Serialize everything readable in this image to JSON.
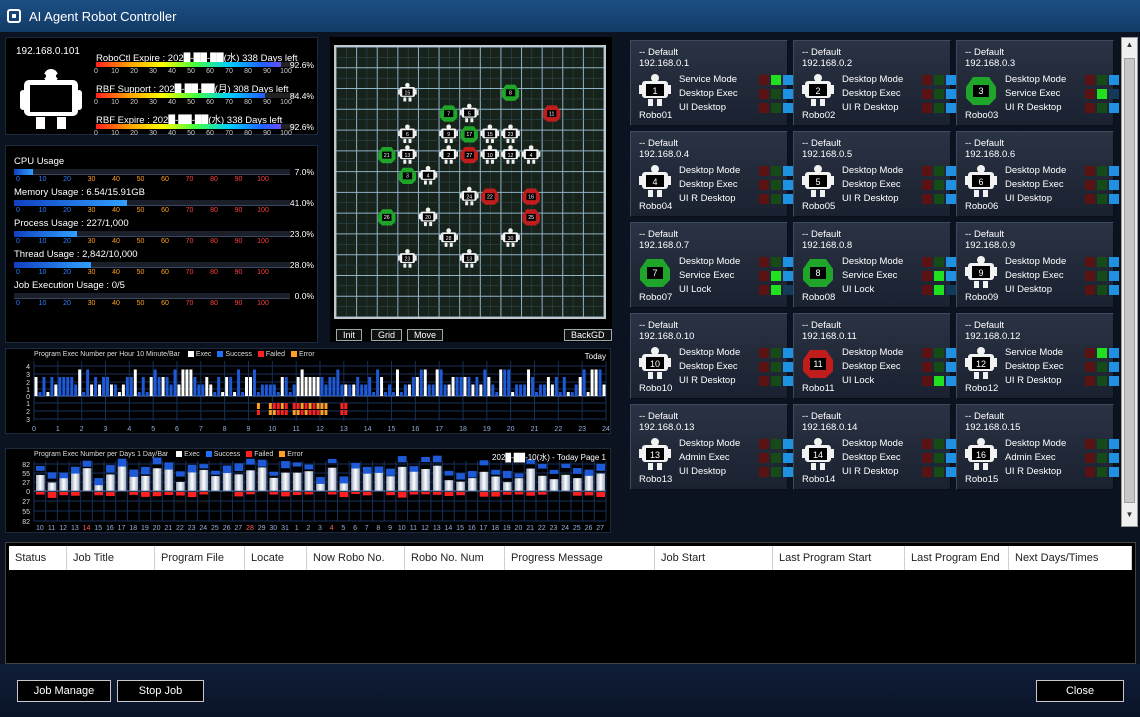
{
  "window": {
    "title": "AI Agent Robot Controller"
  },
  "info": {
    "ip": "192.168.0.101",
    "licenses": [
      {
        "text": "RoboCtl Expire : 202█-██-██(水) 338 Days left",
        "percent": "92.6%",
        "fill": 0.926
      },
      {
        "text": "RBF Support   : 202█-██-██(月) 308 Days left",
        "percent": "84.4%",
        "fill": 0.844
      },
      {
        "text": "RBF Expire    : 202█-██-██(水) 338 Days left",
        "percent": "92.6%",
        "fill": 0.926
      }
    ],
    "ticks": [
      "0",
      "10",
      "20",
      "30",
      "40",
      "50",
      "60",
      "70",
      "80",
      "90",
      "100"
    ]
  },
  "usage": [
    {
      "label": "CPU Usage",
      "percent": "7.0%",
      "fill": 0.07
    },
    {
      "label": "Memory Usage : 6.54/15.91GB",
      "percent": "41.0%",
      "fill": 0.41
    },
    {
      "label": "Process Usage : 227/1,000",
      "percent": "23.0%",
      "fill": 0.23
    },
    {
      "label": "Thread Usage : 2,842/10,000",
      "percent": "28.0%",
      "fill": 0.28
    },
    {
      "label": "Job Execution Usage : 0/5",
      "percent": "0.0%",
      "fill": 0.0
    }
  ],
  "usage_ticks": [
    "0",
    "10",
    "20",
    "30",
    "40",
    "50",
    "60",
    "70",
    "80",
    "90",
    "100"
  ],
  "map": {
    "buttons": {
      "init": "Init",
      "grid": "Grid",
      "move": "Move",
      "backgd": "BackGD"
    },
    "grid_cols": 13,
    "grid_rows": 13,
    "robots": [
      {
        "n": "15",
        "col": 3,
        "row": 2,
        "c": "w"
      },
      {
        "n": "8",
        "col": 8,
        "row": 2,
        "c": "g"
      },
      {
        "n": "7",
        "col": 5,
        "row": 3,
        "c": "g"
      },
      {
        "n": "5",
        "col": 6,
        "row": 3,
        "c": "w"
      },
      {
        "n": "11",
        "col": 10,
        "row": 3,
        "c": "r"
      },
      {
        "n": "6",
        "col": 3,
        "row": 4,
        "c": "w"
      },
      {
        "n": "9",
        "col": 5,
        "row": 4,
        "c": "w"
      },
      {
        "n": "17",
        "col": 6,
        "row": 4,
        "c": "g"
      },
      {
        "n": "15",
        "col": 7,
        "row": 4,
        "c": "w"
      },
      {
        "n": "23",
        "col": 8,
        "row": 4,
        "c": "w"
      },
      {
        "n": "21",
        "col": 2,
        "row": 5,
        "c": "g"
      },
      {
        "n": "13",
        "col": 3,
        "row": 5,
        "c": "w"
      },
      {
        "n": "2",
        "col": 5,
        "row": 5,
        "c": "w"
      },
      {
        "n": "27",
        "col": 6,
        "row": 5,
        "c": "r"
      },
      {
        "n": "10",
        "col": 7,
        "row": 5,
        "c": "w"
      },
      {
        "n": "12",
        "col": 8,
        "row": 5,
        "c": "w"
      },
      {
        "n": "4",
        "col": 9,
        "row": 5,
        "c": "w"
      },
      {
        "n": "3",
        "col": 3,
        "row": 6,
        "c": "g"
      },
      {
        "n": "4",
        "col": 4,
        "row": 6,
        "c": "w"
      },
      {
        "n": "24",
        "col": 6,
        "row": 7,
        "c": "w"
      },
      {
        "n": "22",
        "col": 7,
        "row": 7,
        "c": "r"
      },
      {
        "n": "16",
        "col": 9,
        "row": 7,
        "c": "r"
      },
      {
        "n": "26",
        "col": 2,
        "row": 8,
        "c": "g"
      },
      {
        "n": "20",
        "col": 4,
        "row": 8,
        "c": "w"
      },
      {
        "n": "25",
        "col": 9,
        "row": 8,
        "c": "r"
      },
      {
        "n": "28",
        "col": 5,
        "row": 9,
        "c": "w"
      },
      {
        "n": "30",
        "col": 8,
        "row": 9,
        "c": "w"
      },
      {
        "n": "23",
        "col": 3,
        "row": 10,
        "c": "w"
      },
      {
        "n": "13",
        "col": 6,
        "row": 10,
        "c": "w"
      }
    ]
  },
  "hour_chart": {
    "header": "Program Exec Number per Hour  10 Minute/Bar",
    "legend": [
      "Exec",
      "Success",
      "Failed",
      "Error"
    ],
    "legend_colors": [
      "#ffffff",
      "#2070ff",
      "#ff2020",
      "#ffa020"
    ],
    "right": "Today",
    "yticks": [
      "4",
      "3",
      "2",
      "1",
      "0",
      "1",
      "2",
      "3"
    ],
    "xticks": [
      "0",
      "1",
      "2",
      "3",
      "4",
      "5",
      "6",
      "7",
      "8",
      "9",
      "10",
      "11",
      "12",
      "13",
      "14",
      "15",
      "16",
      "17",
      "18",
      "19",
      "20",
      "21",
      "22",
      "23",
      "24"
    ]
  },
  "day_chart": {
    "header": "Program Exec Number per Days  1 Day/Bar",
    "legend": [
      "Exec",
      "Success",
      "Failed",
      "Error"
    ],
    "legend_colors": [
      "#ffffff",
      "#2070ff",
      "#ff2020",
      "#ffa020"
    ],
    "right": "202█-██-10(水) - Today Page 1",
    "yticks": [
      "82",
      "55",
      "27",
      "0",
      "27",
      "55",
      "82"
    ],
    "xticks": [
      "10",
      "11",
      "12",
      "13",
      "14",
      "15",
      "16",
      "17",
      "18",
      "19",
      "20",
      "21",
      "22",
      "23",
      "24",
      "25",
      "26",
      "27",
      "28",
      "29",
      "30",
      "31",
      "1",
      "2",
      "3",
      "4",
      "5",
      "6",
      "7",
      "8",
      "9",
      "10",
      "11",
      "12",
      "13",
      "14",
      "15",
      "16",
      "17",
      "18",
      "19",
      "20",
      "21",
      "22",
      "23",
      "24",
      "25",
      "26",
      "27"
    ]
  },
  "robots": [
    {
      "group": "-- Default",
      "ip": "192.168.0.1",
      "num": "1",
      "name": "Robo01",
      "color": "w",
      "rows": [
        {
          "label": "Service Mode",
          "s": [
            "off-r",
            "on-g",
            "on-b"
          ]
        },
        {
          "label": "Desktop Exec",
          "s": [
            "off-r",
            "off-g",
            "on-b"
          ]
        },
        {
          "label": "UI Desktop",
          "s": [
            "off-r",
            "off-g",
            "on-b"
          ]
        }
      ]
    },
    {
      "group": "-- Default",
      "ip": "192.168.0.2",
      "num": "2",
      "name": "Robo02",
      "color": "w",
      "rows": [
        {
          "label": "Desktop Mode",
          "s": [
            "off-r",
            "off-g",
            "on-b"
          ]
        },
        {
          "label": "Desktop Exec",
          "s": [
            "off-r",
            "off-g",
            "on-b"
          ]
        },
        {
          "label": "UI R Desktop",
          "s": [
            "off-r",
            "off-g",
            "on-b"
          ]
        }
      ]
    },
    {
      "group": "-- Default",
      "ip": "192.168.0.3",
      "num": "3",
      "name": "Robo03",
      "color": "g",
      "rows": [
        {
          "label": "Desktop Mode",
          "s": [
            "off-r",
            "off-g",
            "on-b"
          ]
        },
        {
          "label": "Service Exec",
          "s": [
            "off-r",
            "on-g",
            "off-b"
          ]
        },
        {
          "label": "UI R Desktop",
          "s": [
            "off-r",
            "off-g",
            "on-b"
          ]
        }
      ]
    },
    {
      "group": "-- Default",
      "ip": "192.168.0.4",
      "num": "4",
      "name": "Robo04",
      "color": "w",
      "rows": [
        {
          "label": "Desktop Mode",
          "s": [
            "off-r",
            "off-g",
            "on-b"
          ]
        },
        {
          "label": "Desktop Exec",
          "s": [
            "off-r",
            "off-g",
            "on-b"
          ]
        },
        {
          "label": "UI R Desktop",
          "s": [
            "off-r",
            "off-g",
            "on-b"
          ]
        }
      ]
    },
    {
      "group": "-- Default",
      "ip": "192.168.0.5",
      "num": "5",
      "name": "Robo05",
      "color": "w",
      "rows": [
        {
          "label": "Desktop Mode",
          "s": [
            "off-r",
            "off-g",
            "on-b"
          ]
        },
        {
          "label": "Desktop Exec",
          "s": [
            "off-r",
            "off-g",
            "on-b"
          ]
        },
        {
          "label": "UI R Desktop",
          "s": [
            "off-r",
            "off-g",
            "on-b"
          ]
        }
      ]
    },
    {
      "group": "-- Default",
      "ip": "192.168.0.6",
      "num": "6",
      "name": "Robo06",
      "color": "w",
      "rows": [
        {
          "label": "Desktop Mode",
          "s": [
            "off-r",
            "off-g",
            "on-b"
          ]
        },
        {
          "label": "Desktop Exec",
          "s": [
            "off-r",
            "off-g",
            "on-b"
          ]
        },
        {
          "label": "UI Desktop",
          "s": [
            "off-r",
            "off-g",
            "on-b"
          ]
        }
      ]
    },
    {
      "group": "-- Default",
      "ip": "192.168.0.7",
      "num": "7",
      "name": "Robo07",
      "color": "g",
      "rows": [
        {
          "label": "Desktop Mode",
          "s": [
            "off-r",
            "off-g",
            "on-b"
          ]
        },
        {
          "label": "Service Exec",
          "s": [
            "off-r",
            "on-g",
            "on-b"
          ]
        },
        {
          "label": "UI Lock",
          "s": [
            "off-r",
            "on-g",
            "off-b"
          ]
        }
      ]
    },
    {
      "group": "-- Default",
      "ip": "192.168.0.8",
      "num": "8",
      "name": "Robo08",
      "color": "g",
      "rows": [
        {
          "label": "Desktop Mode",
          "s": [
            "off-r",
            "off-g",
            "on-b"
          ]
        },
        {
          "label": "Service Exec",
          "s": [
            "off-r",
            "on-g",
            "on-b"
          ]
        },
        {
          "label": "UI Lock",
          "s": [
            "off-r",
            "on-g",
            "off-b"
          ]
        }
      ]
    },
    {
      "group": "-- Default",
      "ip": "192.168.0.9",
      "num": "9",
      "name": "Robo09",
      "color": "w",
      "rows": [
        {
          "label": "Desktop Mode",
          "s": [
            "off-r",
            "off-g",
            "on-b"
          ]
        },
        {
          "label": "Desktop Exec",
          "s": [
            "off-r",
            "off-g",
            "on-b"
          ]
        },
        {
          "label": "UI Desktop",
          "s": [
            "off-r",
            "off-g",
            "on-b"
          ]
        }
      ]
    },
    {
      "group": "-- Default",
      "ip": "192.168.0.10",
      "num": "10",
      "name": "Robo10",
      "color": "w",
      "rows": [
        {
          "label": "Desktop Mode",
          "s": [
            "off-r",
            "off-g",
            "on-b"
          ]
        },
        {
          "label": "Desktop Exec",
          "s": [
            "off-r",
            "off-g",
            "on-b"
          ]
        },
        {
          "label": "UI R Desktop",
          "s": [
            "off-r",
            "off-g",
            "on-b"
          ]
        }
      ]
    },
    {
      "group": "-- Default",
      "ip": "192.168.0.11",
      "num": "11",
      "name": "Robo11",
      "color": "r",
      "rows": [
        {
          "label": "Desktop Mode",
          "s": [
            "off-r",
            "off-g",
            "on-b"
          ]
        },
        {
          "label": "Desktop Exec",
          "s": [
            "off-r",
            "off-g",
            "on-b"
          ]
        },
        {
          "label": "UI Lock",
          "s": [
            "off-r",
            "on-g",
            "on-b"
          ]
        }
      ]
    },
    {
      "group": "-- Default",
      "ip": "192.168.0.12",
      "num": "12",
      "name": "Robo12",
      "color": "w",
      "rows": [
        {
          "label": "Service Mode",
          "s": [
            "off-r",
            "on-g",
            "on-b"
          ]
        },
        {
          "label": "Desktop Exec",
          "s": [
            "off-r",
            "off-g",
            "on-b"
          ]
        },
        {
          "label": "UI R Desktop",
          "s": [
            "off-r",
            "off-g",
            "on-b"
          ]
        }
      ]
    },
    {
      "group": "-- Default",
      "ip": "192.168.0.13",
      "num": "13",
      "name": "Robo13",
      "color": "w",
      "rows": [
        {
          "label": "Desktop Mode",
          "s": [
            "off-r",
            "off-g",
            "on-b"
          ]
        },
        {
          "label": "Admin Exec",
          "s": [
            "off-r",
            "off-g",
            "on-b"
          ]
        },
        {
          "label": "UI Desktop",
          "s": [
            "off-r",
            "off-g",
            "on-b"
          ]
        }
      ]
    },
    {
      "group": "-- Default",
      "ip": "192.168.0.14",
      "num": "14",
      "name": "Robo14",
      "color": "w",
      "rows": [
        {
          "label": "Desktop Mode",
          "s": [
            "off-r",
            "off-g",
            "on-b"
          ]
        },
        {
          "label": "Desktop Exec",
          "s": [
            "off-r",
            "off-g",
            "on-b"
          ]
        },
        {
          "label": "UI R Desktop",
          "s": [
            "off-r",
            "off-g",
            "on-b"
          ]
        }
      ]
    },
    {
      "group": "-- Default",
      "ip": "192.168.0.15",
      "num": "16",
      "name": "Robo15",
      "color": "w",
      "rows": [
        {
          "label": "Desktop Mode",
          "s": [
            "off-r",
            "off-g",
            "on-b"
          ]
        },
        {
          "label": "Admin Exec",
          "s": [
            "off-r",
            "off-g",
            "on-b"
          ]
        },
        {
          "label": "UI R Desktop",
          "s": [
            "off-r",
            "off-g",
            "on-b"
          ]
        }
      ]
    }
  ],
  "job_table": {
    "columns": [
      "Status",
      "Job Title",
      "Program File",
      "Locate",
      "Now Robo No.",
      "Robo No. Num",
      "Progress Message",
      "Job Start",
      "Last Program Start",
      "Last Program End",
      "Next Days/Times"
    ]
  },
  "buttons": {
    "job_manage": "Job Manage",
    "stop_job": "Stop Job",
    "close": "Close"
  },
  "colors": {
    "robot_white": "#f2f2f2",
    "robot_green": "#1fa52a",
    "robot_red": "#c21d1d",
    "grid_line": "#8fb3c8",
    "status_red_on": "#e01b1b",
    "status_red_off": "#5a1212",
    "status_green_on": "#20e020",
    "status_green_off": "#164a16",
    "status_blue_on": "#2090e0",
    "status_blue_off": "#143a5a"
  }
}
